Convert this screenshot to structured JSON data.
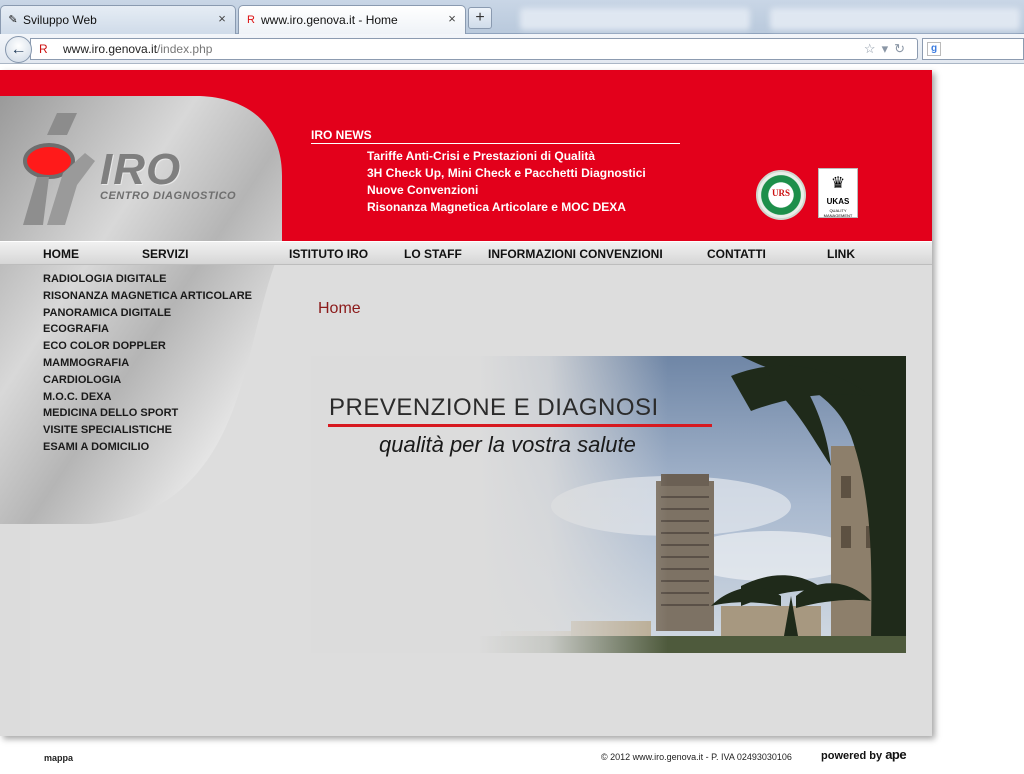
{
  "browser": {
    "tabs": [
      {
        "label": "Sviluppo Web",
        "active": false
      },
      {
        "label": "www.iro.genova.it - Home",
        "active": true
      }
    ],
    "new_tab": "+",
    "close_glyph": "×",
    "url_host": "www.iro.genova.it",
    "url_path": "/index.php",
    "icons": {
      "back": "back-arrow-icon",
      "star": "bookmark-star-icon",
      "reload": "reload-icon",
      "search_engine": "google-icon"
    }
  },
  "header": {
    "logo": {
      "name": "IRO",
      "subtitle": "CENTRO DIAGNOSTICO"
    },
    "news_title": "IRO NEWS",
    "news": [
      "Tariffe Anti-Crisi e Prestazioni di Qualità",
      "3H Check Up, Mini Check e Pacchetti Diagnostici",
      "Nuove Convenzioni",
      "Risonanza Magnetica Articolare e MOC DEXA"
    ],
    "badges": {
      "urs": "URS",
      "ukas": "UKAS",
      "ukas_sub": "QUALITY MANAGEMENT"
    }
  },
  "menu": [
    {
      "label": "HOME"
    },
    {
      "label": "SERVIZI"
    },
    {
      "label": "ISTITUTO IRO"
    },
    {
      "label": "LO STAFF"
    },
    {
      "label": "INFORMAZIONI CONVENZIONI"
    },
    {
      "label": "CONTATTI"
    },
    {
      "label": "LINK"
    }
  ],
  "services": [
    "RADIOLOGIA DIGITALE",
    "RISONANZA MAGNETICA ARTICOLARE",
    "PANORAMICA DIGITALE",
    "ECOGRAFIA",
    "ECO COLOR DOPPLER",
    "MAMMOGRAFIA",
    "CARDIOLOGIA",
    "M.O.C. DEXA",
    "MEDICINA DELLO SPORT",
    "VISITE SPECIALISTICHE",
    "ESAMI A DOMICILIO"
  ],
  "main": {
    "breadcrumb": "Home",
    "banner_title": "PREVENZIONE E DIAGNOSI",
    "banner_subtitle": "qualità per la vostra salute"
  },
  "footer": {
    "mappa": "mappa",
    "copyright": "© 2012 www.iro.genova.it - P. IVA 02493030106",
    "powered_by": "powered by",
    "powered_brand": "ape"
  },
  "colors": {
    "brand_red": "#e3001b",
    "page_gray": "#dddddd",
    "crumb": "#8b1a1a"
  }
}
